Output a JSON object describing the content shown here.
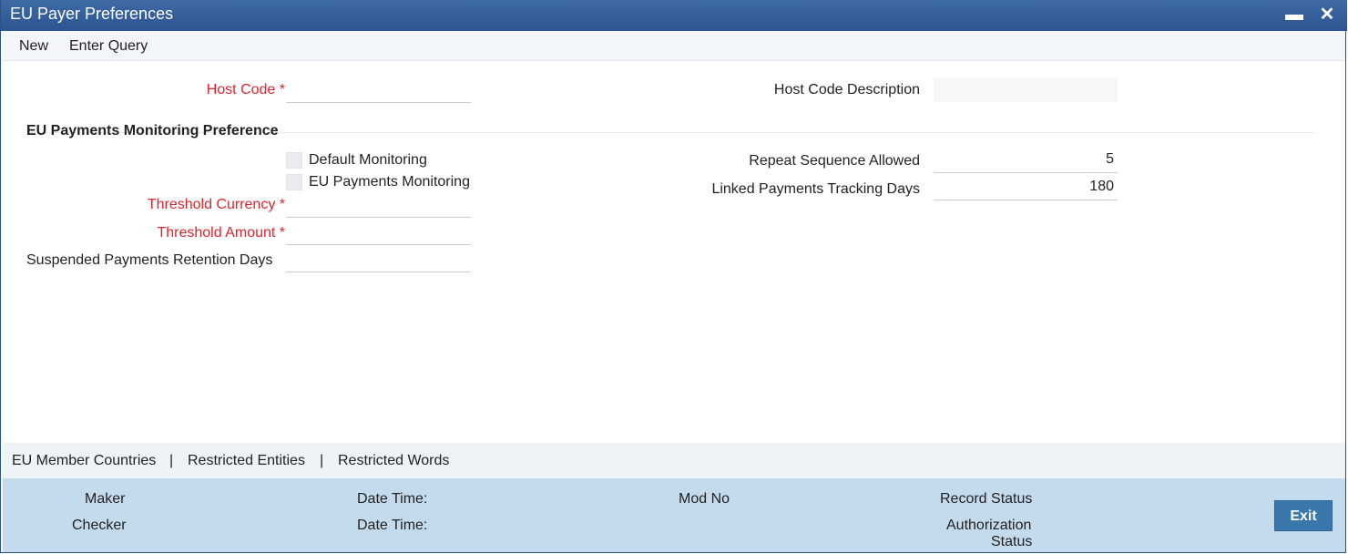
{
  "window": {
    "title": "EU Payer Preferences",
    "minimize_glyph": "▬",
    "close_glyph": "✕"
  },
  "menu": {
    "new_label": "New",
    "enter_query_label": "Enter Query"
  },
  "form": {
    "host_code_label": "Host Code",
    "host_code_value": "",
    "host_code_desc_label": "Host Code Description",
    "host_code_desc_value": "",
    "section_title": "EU Payments Monitoring Preference",
    "default_monitoring_label": "Default Monitoring",
    "eu_payments_monitoring_label": "EU Payments Monitoring",
    "threshold_currency_label": "Threshold Currency",
    "threshold_currency_value": "",
    "threshold_amount_label": "Threshold Amount",
    "threshold_amount_value": "",
    "suspended_retention_label": "Suspended Payments Retention Days",
    "suspended_retention_value": "",
    "repeat_sequence_label": "Repeat Sequence Allowed",
    "repeat_sequence_value": "5",
    "linked_tracking_label": "Linked Payments Tracking Days",
    "linked_tracking_value": "180",
    "required_marker": "*"
  },
  "tabs": {
    "eu_member_countries": "EU Member Countries",
    "restricted_entities": "Restricted Entities",
    "restricted_words": "Restricted Words",
    "separator": "|"
  },
  "footer": {
    "maker_label": "Maker",
    "checker_label": "Checker",
    "date_time_label": "Date Time:",
    "mod_no_label": "Mod No",
    "record_status_label": "Record Status",
    "authorization_label_line1": "Authorization",
    "authorization_label_line2": "Status",
    "exit_label": "Exit"
  },
  "colors": {
    "title_bar": "#2d5591",
    "required_label": "#d9262e",
    "footer_bg": "#c3dbed",
    "exit_button": "#3a77ab"
  }
}
